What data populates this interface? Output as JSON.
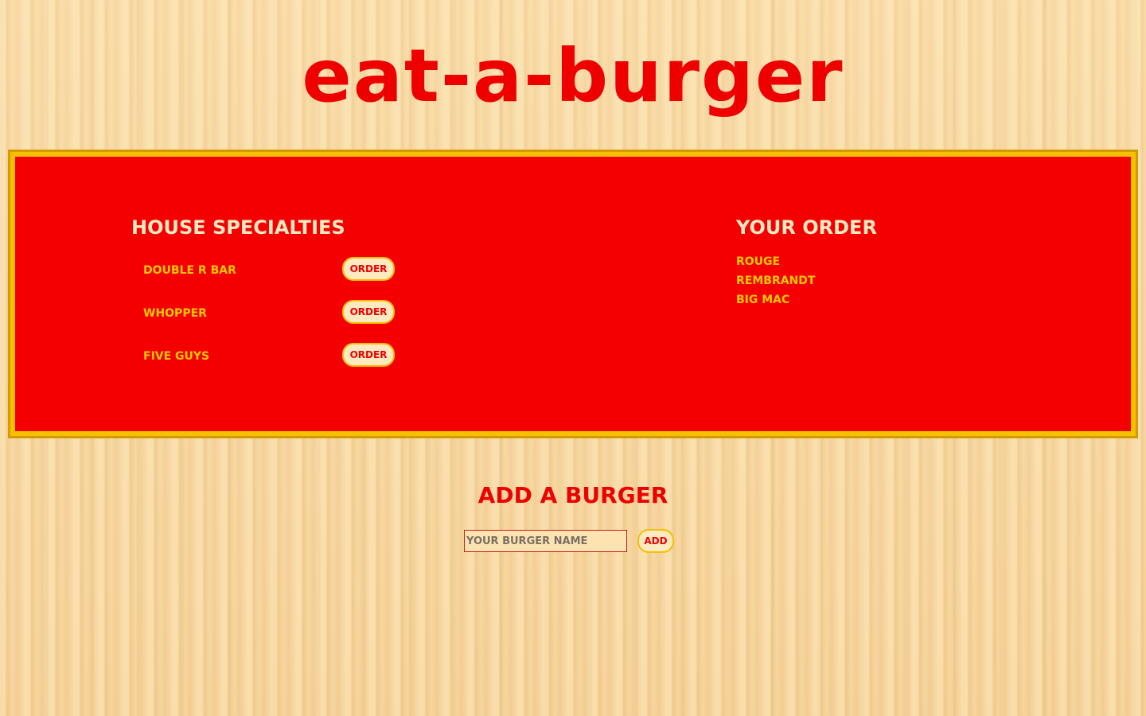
{
  "header": {
    "title": "eat-a-burger"
  },
  "specialties": {
    "heading": "House Specialties",
    "items": [
      {
        "name": "Double R Bar",
        "button_label": "Order"
      },
      {
        "name": "Whopper",
        "button_label": "Order"
      },
      {
        "name": "Five Guys",
        "button_label": "Order"
      }
    ]
  },
  "your_order": {
    "heading": "Your Order",
    "items": [
      "Rouge",
      "Rembrandt",
      "Big Mac"
    ]
  },
  "add_burger": {
    "heading": "Add a Burger",
    "input_placeholder": "Your Burger Name",
    "input_value": "",
    "button_label": "Add"
  },
  "colors": {
    "title_red": "#ee0000",
    "board_red": "#f40000",
    "board_border_gold": "#f4c000",
    "item_yellow": "#f7c900",
    "heading_cream": "#fde9c2",
    "wood_background": "#f6d49c"
  }
}
